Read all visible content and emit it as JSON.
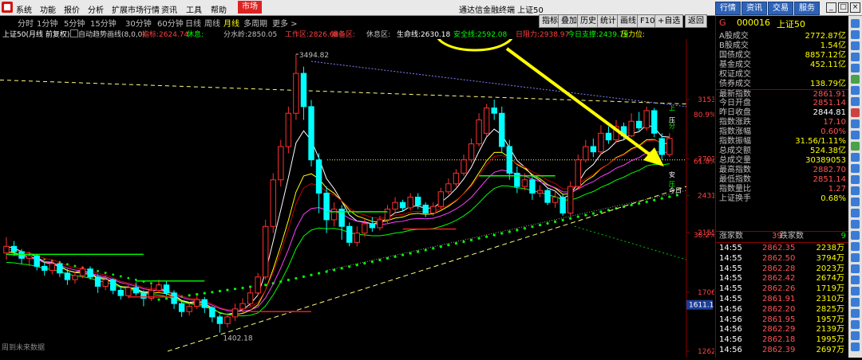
{
  "menubar": {
    "items": [
      "系统",
      "功能",
      "报价",
      "分析",
      "扩展市场行情",
      "资讯",
      "工具",
      "帮助"
    ],
    "market_label": "市场",
    "title": "通达信金融终端  上证50",
    "right_buttons": [
      "行情",
      "资讯",
      "交易",
      "服务"
    ]
  },
  "toolbar": {
    "tabs": [
      "分时",
      "1分钟",
      "5分钟",
      "15分钟",
      "30分钟",
      "60分钟",
      "日线",
      "周线",
      "月线",
      "多周期",
      "更多 >"
    ],
    "active_tab": "月线",
    "right_buttons": [
      "指标",
      "叠加",
      "历史",
      "统计",
      "画线",
      "F10",
      "+自选",
      "返回"
    ]
  },
  "infobar": {
    "name": "上证50(月线 前复权)",
    "indicator": "自动趋势画线(8,0,0)",
    "items": [
      {
        "label": "指标:",
        "value": "2624.74",
        "color": "#ff4040"
      },
      {
        "label": "休息:",
        "value": "",
        "color": "#00ff00"
      },
      {
        "label": "分水岭:",
        "value": "2850.05",
        "color": "#c0c0c0"
      },
      {
        "label": "工作区:",
        "value": "2826.68",
        "color": "#ff4040"
      },
      {
        "label": "准备区:",
        "value": "",
        "color": "#ff4040"
      },
      {
        "label": "休息区:",
        "value": "",
        "color": "#c0c0c0"
      },
      {
        "label": "生命线:",
        "value": "2630.18",
        "color": "#ffffff"
      },
      {
        "label": "安全线:",
        "value": "2592.08",
        "color": "#00ff00"
      },
      {
        "label": "日阻力:",
        "value": "2938.97",
        "color": "#ff4040"
      },
      {
        "label": "今日支撑:",
        "value": "2439.79",
        "color": "#00ff00"
      },
      {
        "label": "压力位:",
        "value": "",
        "color": "#ffff00"
      }
    ]
  },
  "chart": {
    "price_labels": [
      "3153",
      "2707",
      "2431",
      "2155",
      "1706",
      "1262"
    ],
    "pct_labels": [
      "80.9%",
      "61.8%",
      "38.2%"
    ],
    "current_price_tag": "1611.1",
    "high_annotation": "3494.82",
    "low_annotation": "1402.18",
    "footer_note": "周到未来数据",
    "right_markers": [
      "上",
      "压",
      "分",
      "安",
      "压",
      "今日"
    ]
  },
  "chart_data": {
    "type": "candlestick",
    "title": "上证50(月线 前复权)",
    "annotations": [
      "3494.82",
      "1402.18"
    ],
    "price_axis_ticks": [
      3153,
      2707,
      2431,
      2155,
      1706,
      1262
    ],
    "ylim": [
      1262,
      3560
    ],
    "current_value": 2861.91
  },
  "quote": {
    "header_tag": "G",
    "code": "000016",
    "name": "上证50",
    "rows": [
      {
        "k": "A股成交",
        "v": "2772.87亿",
        "c": "#ffff00"
      },
      {
        "k": "B股成交",
        "v": "1.54亿",
        "c": "#ffff00"
      },
      {
        "k": "国债成交",
        "v": "8857.12亿",
        "c": "#ffff00"
      },
      {
        "k": "基金成交",
        "v": "452.11亿",
        "c": "#ffff00"
      },
      {
        "k": "权证成交",
        "v": "",
        "c": "#ffff00"
      },
      {
        "k": "债券成交",
        "v": "138.79亿",
        "c": "#ffff00"
      },
      {
        "k": "最新指数",
        "v": "2861.91",
        "c": "#ff5555"
      },
      {
        "k": "今日开盘",
        "v": "2851.14",
        "c": "#ff5555"
      },
      {
        "k": "昨日收盘",
        "v": "2844.81",
        "c": "#ffffff"
      },
      {
        "k": "指数涨跌",
        "v": "17.10",
        "c": "#ff5555"
      },
      {
        "k": "指数涨幅",
        "v": "0.60%",
        "c": "#ff5555"
      },
      {
        "k": "指数振幅",
        "v": "31.56/1.11%",
        "c": "#ffff00"
      },
      {
        "k": "总成交额",
        "v": "524.38亿",
        "c": "#ffff00"
      },
      {
        "k": "总成交量",
        "v": "30389053",
        "c": "#ffff00"
      },
      {
        "k": "最高指数",
        "v": "2882.70",
        "c": "#ff5555"
      },
      {
        "k": "最低指数",
        "v": "2851.14",
        "c": "#ff5555"
      },
      {
        "k": "指数量比",
        "v": "1.27",
        "c": "#ff5555"
      },
      {
        "k": "上证换手",
        "v": "0.68%",
        "c": "#ffff00"
      }
    ],
    "updown": {
      "up_label": "涨家数",
      "up": "39",
      "down_label": "跌家数",
      "down": "9"
    },
    "ticks": [
      {
        "t": "14:55",
        "p": "2862.35",
        "q": "2238万"
      },
      {
        "t": "14:55",
        "p": "2862.50",
        "q": "3794万"
      },
      {
        "t": "14:55",
        "p": "2862.28",
        "q": "2023万"
      },
      {
        "t": "14:55",
        "p": "2862.42",
        "q": "2674万"
      },
      {
        "t": "14:55",
        "p": "2862.26",
        "q": "1719万"
      },
      {
        "t": "14:55",
        "p": "2861.91",
        "q": "2310万"
      },
      {
        "t": "14:56",
        "p": "2862.20",
        "q": "2825万"
      },
      {
        "t": "14:56",
        "p": "2861.95",
        "q": "1957万"
      },
      {
        "t": "14:56",
        "p": "2862.29",
        "q": "2139万"
      },
      {
        "t": "14:56",
        "p": "2862.18",
        "q": "1995万"
      },
      {
        "t": "14:56",
        "p": "2862.39",
        "q": "2697万"
      }
    ]
  }
}
